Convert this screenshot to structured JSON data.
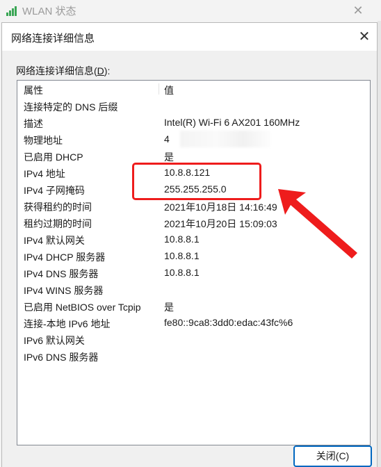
{
  "parent_window": {
    "title": "WLAN 状态",
    "close_glyph": "✕"
  },
  "dialog": {
    "title": "网络连接详细信息",
    "close_glyph": "✕",
    "section_label_main": "网络连接详细信息(",
    "section_label_mnemonic": "D",
    "section_label_end": "):",
    "columns": [
      "属性",
      "值"
    ],
    "rows": [
      {
        "prop": "连接特定的 DNS 后缀",
        "val": ""
      },
      {
        "prop": "描述",
        "val": "Intel(R) Wi-Fi 6 AX201 160MHz"
      },
      {
        "prop": "物理地址",
        "val": "4"
      },
      {
        "prop": "已启用 DHCP",
        "val": "是"
      },
      {
        "prop": "IPv4 地址",
        "val": "10.8.8.121"
      },
      {
        "prop": "IPv4 子网掩码",
        "val": "255.255.255.0"
      },
      {
        "prop": "获得租约的时间",
        "val": "2021年10月18日 14:16:49"
      },
      {
        "prop": "租约过期的时间",
        "val": "2021年10月20日 15:09:03"
      },
      {
        "prop": "IPv4 默认网关",
        "val": "10.8.8.1"
      },
      {
        "prop": "IPv4 DHCP 服务器",
        "val": "10.8.8.1"
      },
      {
        "prop": "IPv4 DNS 服务器",
        "val": "10.8.8.1"
      },
      {
        "prop": "IPv4 WINS 服务器",
        "val": ""
      },
      {
        "prop": "已启用 NetBIOS over Tcpip",
        "val": "是"
      },
      {
        "prop": "连接-本地 IPv6 地址",
        "val": "fe80::9ca8:3dd0:edac:43fc%6"
      },
      {
        "prop": "IPv6 默认网关",
        "val": ""
      },
      {
        "prop": "IPv6 DNS 服务器",
        "val": ""
      }
    ],
    "close_button": "关闭(C)"
  },
  "annotation": {
    "color": "#ee1c1c"
  }
}
